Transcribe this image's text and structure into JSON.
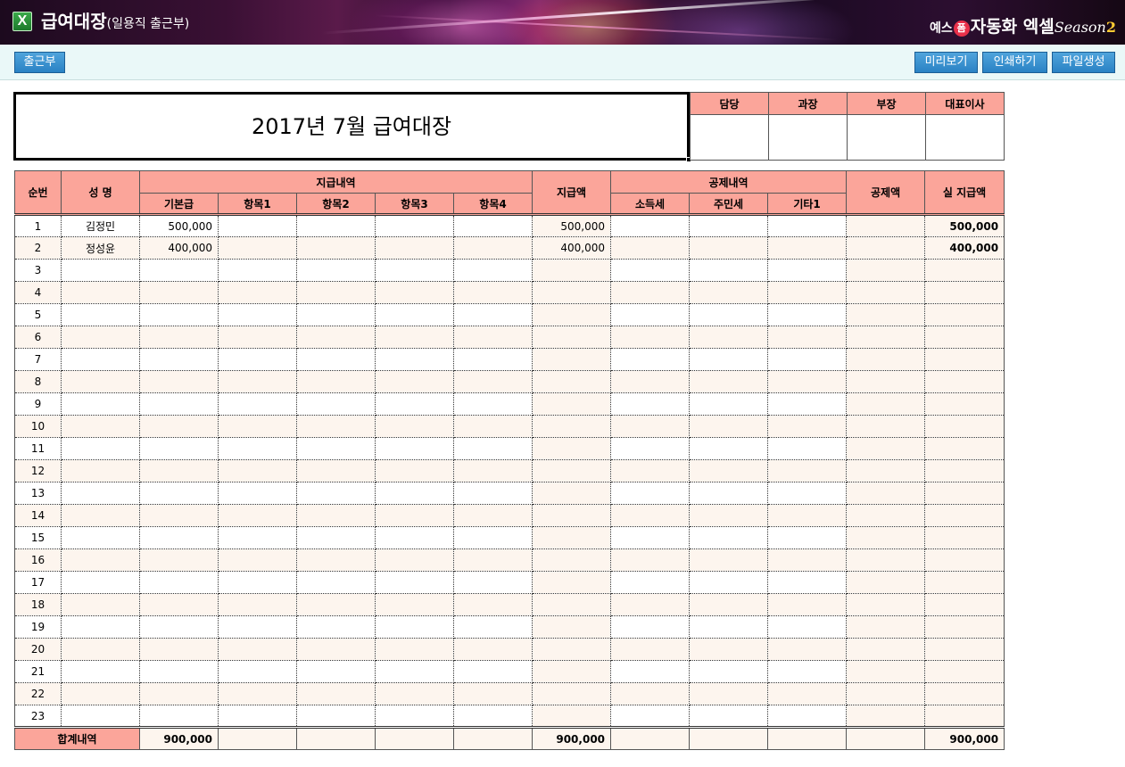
{
  "app": {
    "icon_glyph": "X",
    "title": "급여대장",
    "subtitle": "(일용직 출근부)",
    "brand_part1": "예스",
    "brand_badge": "폼",
    "brand_part2": "자동화 엑셀",
    "brand_part3": "Season",
    "brand_part4": "2"
  },
  "toolbar": {
    "attendance_label": "출근부",
    "preview_label": "미리보기",
    "print_label": "인쇄하기",
    "file_label": "파일생성"
  },
  "document": {
    "title": "2017년 7월 급여대장",
    "approval_headers": [
      "담당",
      "과장",
      "부장",
      "대표이사"
    ]
  },
  "table": {
    "headers": {
      "no": "순번",
      "name": "성 명",
      "payment_group": "지급내역",
      "base_pay": "기본급",
      "item1": "항목1",
      "item2": "항목2",
      "item3": "항목3",
      "item4": "항목4",
      "payment_amount": "지급액",
      "deduction_group": "공제내역",
      "income_tax": "소득세",
      "resident_tax": "주민세",
      "other1": "기타1",
      "deduction_amount": "공제액",
      "net_pay": "실 지급액"
    },
    "rows": [
      {
        "no": "1",
        "name": "김정민",
        "base": "500,000",
        "pay": "500,000",
        "net": "500,000"
      },
      {
        "no": "2",
        "name": "정성윤",
        "base": "400,000",
        "pay": "400,000",
        "net": "400,000"
      },
      {
        "no": "3"
      },
      {
        "no": "4"
      },
      {
        "no": "5"
      },
      {
        "no": "6"
      },
      {
        "no": "7"
      },
      {
        "no": "8"
      },
      {
        "no": "9"
      },
      {
        "no": "10"
      },
      {
        "no": "11"
      },
      {
        "no": "12"
      },
      {
        "no": "13"
      },
      {
        "no": "14"
      },
      {
        "no": "15"
      },
      {
        "no": "16"
      },
      {
        "no": "17"
      },
      {
        "no": "18"
      },
      {
        "no": "19"
      },
      {
        "no": "20"
      },
      {
        "no": "21"
      },
      {
        "no": "22"
      },
      {
        "no": "23"
      }
    ],
    "totals": {
      "label": "합계내역",
      "base": "900,000",
      "pay": "900,000",
      "net": "900,000"
    }
  },
  "colors": {
    "header_fill": "#fba59a",
    "row_alt_fill": "#fdf5ee",
    "toolbar_bg": "#eaf8f8",
    "button_blue": "#2a82c4"
  }
}
